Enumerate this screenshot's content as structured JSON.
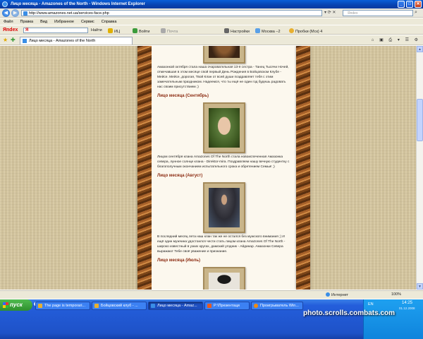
{
  "window": {
    "title": "Лицо месяца - Amazones of the North - Windows Internet Explorer",
    "minimize": "_",
    "maximize": "□",
    "close": "✕"
  },
  "address": {
    "url": "http://www.amazones.net.ua/services-face.php",
    "search_placeholder": "Яndex",
    "back": "◀",
    "forward": "▶",
    "icons": "▾ ⟳ ✕",
    "go": "⌕"
  },
  "menu": [
    "Файл",
    "Правка",
    "Вид",
    "Избранное",
    "Сервис",
    "Справка"
  ],
  "yandex": {
    "logo": "Яndex",
    "search_value": "Я",
    "find": "Найти",
    "ic": "ИЦ",
    "login": "Войти",
    "mail": "Почта",
    "settings": "Настройки",
    "city": "Москва −2",
    "traffic": "Пробки (Мск) 4"
  },
  "tab": {
    "title": "Лицо месяца - Amazones of the North",
    "tools": "⌂ ▣ ⎙ ▾ ☰ ⚙"
  },
  "content": {
    "intro_para": "Амазонкой октября стала наша очаровательная 13-я сестра - Танец Тысячи Ночей, отмечавшая в этом месяце свой первый День Рождения в Бойцовском Клубе - Мейсе. Мейсе, дорогая, Твой  Клан от всей души поздравляет тебя с этим замечательным праздником. Надеемся, что ты ещё не один год будешь радовать нас своим присутствием ;)",
    "september_title": "Лицо месяца (Сентябрь)",
    "september_text": "Лицом сентября клана Amazones Of The North стала новоиспеченная Амазонка севера, лунное солнце клана - Direktor-mira. Поздравляем нашу вечную студентку с благополучным окончанием испытательного срока и обретением  Семьи! ;)",
    "august_title": "Лицо месяца (Август)",
    "august_text": "В последний месяц лета наш клан так же не остался без мужского внимания ;) И ещё один мужчина удостоился чести стать лицом клана  Amazones Of The North - широко известный в узких кругах, дамский угодник - Айдинар. Амазонки Севера выражают Тебе своё уважение и признание.",
    "july_title": "Лицо месяца (Июль)"
  },
  "status": {
    "zone": "Интернет",
    "zoom": "100%"
  },
  "taskbar": {
    "start": "пуск",
    "quick": "⬤ ◆ ◉",
    "tasks": [
      "The page is temporari...",
      "Бойцовский клуб - ...",
      "Лицо месяца - Amaz...",
      "Р:\\Презентаци",
      "Проигрыватель Win..."
    ],
    "lang": "EN",
    "time": "14:25",
    "date": "01.12.2008"
  },
  "watermark": "photo.scrolls.combats.com"
}
